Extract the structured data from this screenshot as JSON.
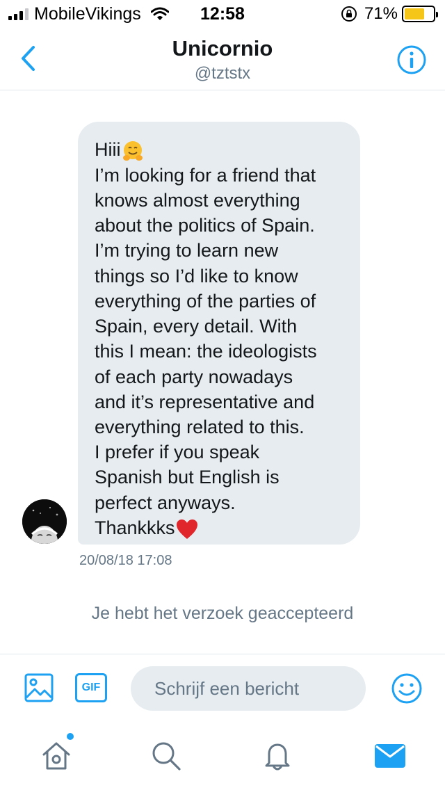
{
  "status_bar": {
    "carrier": "MobileVikings",
    "time": "12:58",
    "battery_percent": "71%",
    "battery_level": 0.71,
    "battery_color": "#f5c518"
  },
  "header": {
    "title": "Unicornio",
    "handle": "@tztstx",
    "back_icon": "chevron-left-icon",
    "info_icon": "info-icon"
  },
  "conversation": {
    "message_text": "Hiii\nI’m looking for a friend that knows almost everything about the politics of Spain. I’m trying to learn new things so I’d like to know everything of the parties of Spain, every detail. With this I mean: the ideologists of each party nowadays and it’s representative and everything related to this.\nI prefer if you speak Spanish but English is perfect anyways.\nThankkks",
    "message_lines": [
      "I’m looking for a friend that",
      "knows almost everything",
      "about the politics of Spain.",
      "I’m trying to learn new",
      "things so I’d like to know",
      "everything of the parties of",
      "Spain, every detail. With",
      "this I mean: the ideologists",
      "of each party nowadays",
      "and it’s representative and",
      "everything related to this.",
      "I prefer if you speak",
      "Spanish but English is",
      "perfect anyways."
    ],
    "greeting": "Hiii",
    "signoff": "Thankkks",
    "greeting_emoji": "hugging-face-emoji",
    "signoff_emoji": "red-heart-emoji",
    "timestamp": "20/08/18 17:08",
    "system_message": "Je hebt het verzoek geaccepteerd"
  },
  "composer": {
    "placeholder": "Schrijf een bericht",
    "gif_label": "GIF",
    "media_icon": "image-icon",
    "emoji_icon": "smiley-icon"
  },
  "tab_bar": {
    "tabs": [
      {
        "name": "home",
        "icon": "home-icon",
        "has_badge": true
      },
      {
        "name": "search",
        "icon": "search-icon"
      },
      {
        "name": "notifications",
        "icon": "bell-icon"
      },
      {
        "name": "messages",
        "icon": "mail-icon",
        "active": true
      }
    ]
  },
  "colors": {
    "accent": "#1da1f2",
    "bubble": "#e6ecf0",
    "secondary_text": "#657786"
  }
}
